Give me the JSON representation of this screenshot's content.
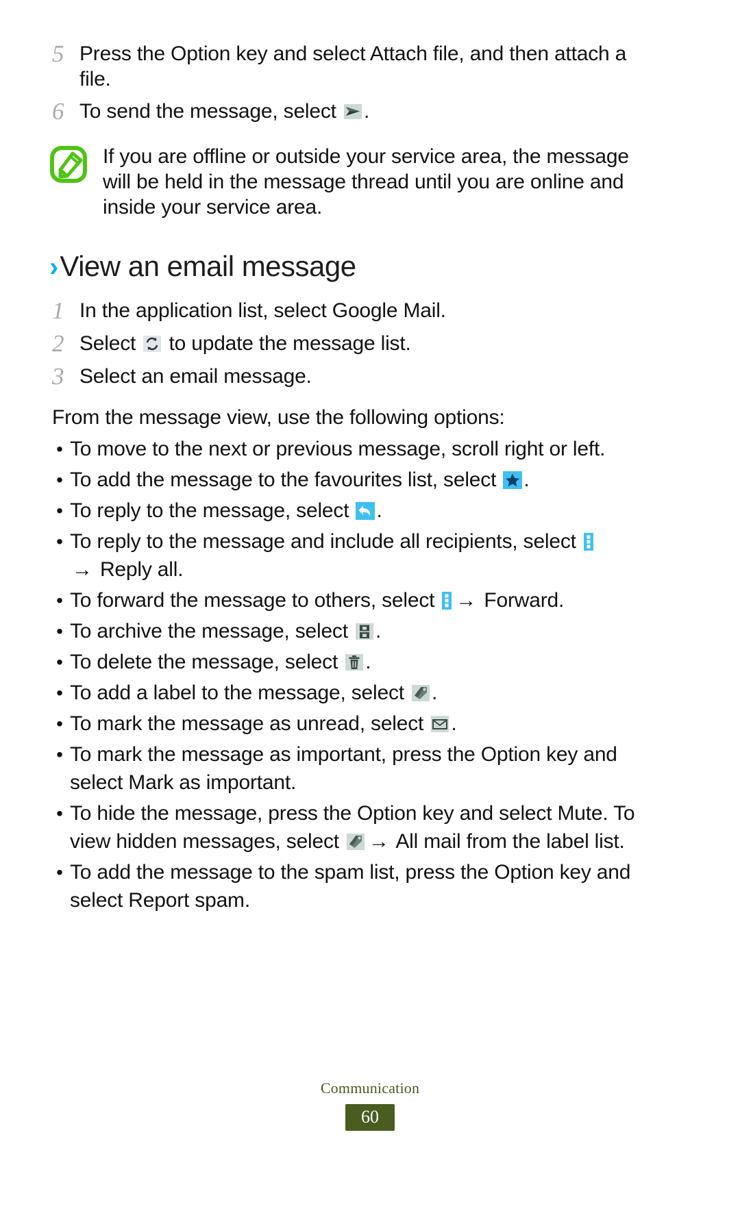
{
  "page": {
    "number": "60",
    "footer_section": "Communication"
  },
  "colors": {
    "accent_cyan": "#00b4f0",
    "icon_chip_cyan": "#3fc0f0",
    "star_navy": "#0d3f73",
    "note_green": "#4fc414",
    "footer_olive": "#4a5c20",
    "step_number_gray": "#a9a9a9",
    "chip_gray": "#c9d6d2",
    "chip_dark": "#3b4a46"
  },
  "steps_top": [
    {
      "number": "5",
      "text": "Press the Option key and select Attach file, and then attach a file."
    },
    {
      "number": "6",
      "text_before": "To send the message, select",
      "icon": "send-paper-plane-icon",
      "text_after": "."
    }
  ],
  "note": {
    "icon": "note-pencil-icon",
    "text": "If you are offline or outside your service area, the message will be held in the message thread until you are online and inside your service area."
  },
  "heading": {
    "chevron": "›",
    "title": "View an email message"
  },
  "steps_view": [
    {
      "number": "1",
      "text": "In the application list, select Google Mail."
    },
    {
      "number": "2",
      "text_before": "Select",
      "icon": "refresh-icon",
      "text_after": "to update the message list."
    },
    {
      "number": "3",
      "text": "Select an email message."
    }
  ],
  "intro_paragraph": "From the message view, use the following options:",
  "bullets": [
    {
      "id": "bullet-scroll",
      "dot": "•",
      "segments": [
        {
          "kind": "text",
          "value": "To move to the next or previous message, scroll right or left."
        }
      ]
    },
    {
      "id": "bullet-favourites",
      "dot": "•",
      "segments": [
        {
          "kind": "text",
          "value": "To add the message to the favourites list, select "
        },
        {
          "kind": "icon",
          "value": "star-icon"
        },
        {
          "kind": "text",
          "value": "."
        }
      ]
    },
    {
      "id": "bullet-reply",
      "dot": "•",
      "segments": [
        {
          "kind": "text",
          "value": "To reply to the message, select "
        },
        {
          "kind": "icon",
          "value": "reply-arrow-icon"
        },
        {
          "kind": "text",
          "value": "."
        }
      ]
    },
    {
      "id": "bullet-reply-all",
      "dot": "•",
      "segments": [
        {
          "kind": "text",
          "value": "To reply to the message and include all recipients, select "
        },
        {
          "kind": "icon",
          "value": "overflow-menu-icon"
        },
        {
          "kind": "break"
        },
        {
          "kind": "arrow",
          "value": "→"
        },
        {
          "kind": "text",
          "value": " Reply all."
        }
      ]
    },
    {
      "id": "bullet-forward",
      "dot": "•",
      "segments": [
        {
          "kind": "text",
          "value": "To forward the message to others, select "
        },
        {
          "kind": "icon",
          "value": "overflow-menu-icon"
        },
        {
          "kind": "arrow",
          "value": "→"
        },
        {
          "kind": "text",
          "value": " Forward."
        }
      ]
    },
    {
      "id": "bullet-archive",
      "dot": "•",
      "segments": [
        {
          "kind": "text",
          "value": "To archive the message, select "
        },
        {
          "kind": "icon",
          "value": "archive-icon"
        },
        {
          "kind": "text",
          "value": "."
        }
      ]
    },
    {
      "id": "bullet-delete",
      "dot": "•",
      "segments": [
        {
          "kind": "text",
          "value": "To delete the message, select "
        },
        {
          "kind": "icon",
          "value": "trash-icon"
        },
        {
          "kind": "text",
          "value": "."
        }
      ]
    },
    {
      "id": "bullet-label",
      "dot": "•",
      "segments": [
        {
          "kind": "text",
          "value": "To add a label to the message, select "
        },
        {
          "kind": "icon",
          "value": "label-tag-icon"
        },
        {
          "kind": "text",
          "value": "."
        }
      ]
    },
    {
      "id": "bullet-unread",
      "dot": "•",
      "segments": [
        {
          "kind": "text",
          "value": "To mark the message as unread, select "
        },
        {
          "kind": "icon",
          "value": "envelope-icon"
        },
        {
          "kind": "text",
          "value": "."
        }
      ]
    },
    {
      "id": "bullet-important",
      "dot": "•",
      "segments": [
        {
          "kind": "text",
          "value": "To mark the message as important, press the Option key and select Mark as important."
        }
      ]
    },
    {
      "id": "bullet-mute",
      "dot": "•",
      "segments": [
        {
          "kind": "text",
          "value": "To hide the message, press the Option key and select Mute. To view hidden messages, select "
        },
        {
          "kind": "icon",
          "value": "folder-label-icon"
        },
        {
          "kind": "arrow",
          "value": "→"
        },
        {
          "kind": "text",
          "value": " All mail from the label list."
        }
      ]
    },
    {
      "id": "bullet-spam",
      "dot": "•",
      "segments": [
        {
          "kind": "text",
          "value": "To add the message to the spam list, press the Option key and select Report spam."
        }
      ]
    }
  ]
}
